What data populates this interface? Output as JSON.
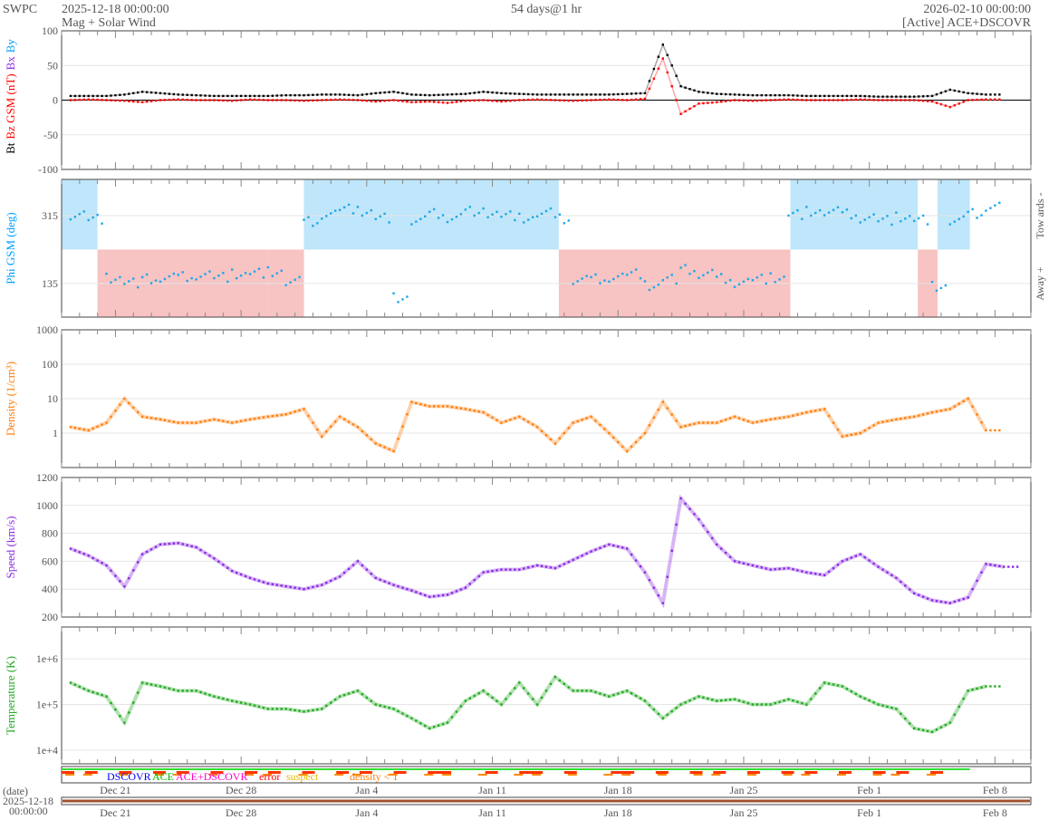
{
  "header": {
    "org": "SWPC",
    "start": "2025-12-18 00:00:00",
    "subtitle": "Mag + Solar Wind",
    "span": "54 days@1 hr",
    "end": "2026-02-10 00:00:00",
    "source": "[Active] ACE+DSCOVR"
  },
  "chart_data": {
    "type": "line",
    "x_unit": "days since 2025-12-18 00:00",
    "x_range": [
      0,
      54
    ],
    "x_ticks": [
      {
        "day": 3,
        "label": "Dec 21"
      },
      {
        "day": 10,
        "label": "Dec 28"
      },
      {
        "day": 17,
        "label": "Jan 4"
      },
      {
        "day": 24,
        "label": "Jan 11"
      },
      {
        "day": 31,
        "label": "Jan 18"
      },
      {
        "day": 38,
        "label": "Jan 25"
      },
      {
        "day": 45,
        "label": "Feb 1"
      },
      {
        "day": 52,
        "label": "Feb 8"
      }
    ],
    "panels": [
      {
        "id": "mag",
        "ylabel_parts": [
          {
            "text": "Bt",
            "color": "#000000"
          },
          {
            "text": "Bz GSM (nT)",
            "color": "#ff0000"
          },
          {
            "text": "Bx",
            "color": "#8a2be2"
          },
          {
            "text": "By",
            "color": "#00a0ff"
          }
        ],
        "scale": "linear",
        "ylim": [
          -100,
          100
        ],
        "yticks": [
          100,
          50,
          0,
          -50,
          -100
        ],
        "series": [
          {
            "name": "Bt",
            "color": "#000000",
            "values": [
              6,
              6,
              6,
              8,
              12,
              10,
              8,
              7,
              6,
              6,
              6,
              6,
              7,
              7,
              8,
              8,
              7,
              10,
              12,
              8,
              7,
              8,
              9,
              12,
              10,
              9,
              8,
              8,
              8,
              8,
              8,
              9,
              10,
              80,
              20,
              12,
              9,
              8,
              7,
              7,
              7,
              6,
              6,
              6,
              6,
              5,
              5,
              5,
              6,
              15,
              10,
              8
            ]
          },
          {
            "name": "Bz",
            "color": "#ff0000",
            "values": [
              0,
              1,
              0,
              -1,
              -3,
              0,
              1,
              0,
              0,
              -1,
              1,
              0,
              0,
              -1,
              0,
              1,
              0,
              -2,
              0,
              -3,
              -2,
              -4,
              -1,
              0,
              -2,
              0,
              1,
              0,
              -1,
              0,
              1,
              0,
              2,
              60,
              -20,
              -5,
              -3,
              0,
              -1,
              0,
              1,
              0,
              0,
              0,
              1,
              0,
              0,
              0,
              -2,
              -10,
              0,
              1
            ]
          }
        ]
      },
      {
        "id": "phi",
        "ylabel": "Phi GSM (deg)",
        "ylabel_color": "#00a0ff",
        "right_labels": [
          "Tow ards -",
          "Away +"
        ],
        "scale": "linear",
        "ylim": [
          46,
          411
        ],
        "yticks": [
          315,
          135
        ],
        "towards_color": "#bfe6fa",
        "away_color": "#f7c3c3",
        "sectors": [
          {
            "from": 0,
            "to": 2,
            "type": "towards"
          },
          {
            "from": 2,
            "to": 11.5,
            "type": "away"
          },
          {
            "from": 11.5,
            "to": 13.5,
            "type": "away"
          },
          {
            "from": 13.5,
            "to": 27.7,
            "type": "towards"
          },
          {
            "from": 27.7,
            "to": 40.6,
            "type": "away"
          },
          {
            "from": 40.6,
            "to": 47.7,
            "type": "towards"
          },
          {
            "from": 47.7,
            "to": 48.8,
            "type": "away"
          },
          {
            "from": 48.8,
            "to": 50.6,
            "type": "towards"
          }
        ],
        "series": [
          {
            "name": "Phi",
            "color": "#1ea7e8",
            "values": [
              320,
              305,
              150,
              140,
              145,
              150,
              155,
              160,
              150,
              160,
              165,
              170,
              140,
              300,
              320,
              330,
              325,
              310,
              100,
              300,
              320,
              310,
              330,
              320,
              315,
              310,
              320,
              305,
              145,
              150,
              155,
              160,
              130,
              150,
              170,
              160,
              150,
              140,
              145,
              150,
              320,
              330,
              325,
              320,
              310,
              300,
              310,
              305,
              130,
              300,
              320,
              340
            ]
          }
        ]
      },
      {
        "id": "density",
        "ylabel": "Density (1/cm³)",
        "ylabel_color": "#ff7f0e",
        "scale": "log",
        "ylim": [
          0.1,
          1000
        ],
        "yticks": [
          1000,
          100,
          10,
          1
        ],
        "series": [
          {
            "name": "Density",
            "color": "#ff7f0e",
            "values": [
              1.5,
              1.2,
              2,
              10,
              3,
              2.5,
              2,
              2,
              2.5,
              2,
              2.5,
              3,
              3.5,
              5,
              0.8,
              3,
              1.5,
              0.5,
              0.3,
              8,
              6,
              6,
              5,
              4,
              2,
              3,
              1.5,
              0.5,
              2,
              3,
              1,
              0.3,
              1,
              8,
              1.5,
              2,
              2,
              3,
              2,
              2.5,
              3,
              4,
              5,
              0.8,
              1,
              2,
              2.5,
              3,
              4,
              5,
              10,
              1.2
            ]
          }
        ]
      },
      {
        "id": "speed",
        "ylabel": "Speed (km/s)",
        "ylabel_color": "#8a2be2",
        "scale": "linear",
        "ylim": [
          200,
          1200
        ],
        "yticks": [
          1200,
          1000,
          800,
          600,
          400,
          200
        ],
        "series": [
          {
            "name": "Speed",
            "color": "#8a2be2",
            "values": [
              690,
              640,
              570,
              420,
              650,
              720,
              730,
              700,
              620,
              530,
              480,
              440,
              420,
              400,
              430,
              490,
              600,
              480,
              430,
              390,
              345,
              360,
              410,
              520,
              540,
              540,
              570,
              550,
              610,
              670,
              720,
              690,
              520,
              300,
              1050,
              900,
              720,
              600,
              570,
              540,
              550,
              520,
              500,
              600,
              650,
              560,
              480,
              370,
              320,
              300,
              340,
              580,
              560
            ]
          }
        ]
      },
      {
        "id": "temperature",
        "ylabel": "Temperature (K)",
        "ylabel_color": "#22aa22",
        "scale": "log",
        "ylim": [
          5000,
          5000000
        ],
        "yticks": [
          1000000,
          100000,
          10000
        ],
        "ytick_labels": [
          "1e+6",
          "1e+5",
          "1e+4"
        ],
        "series": [
          {
            "name": "Temperature",
            "color": "#22aa22",
            "values": [
              300000,
              200000,
              150000,
              40000,
              300000,
              250000,
              200000,
              200000,
              150000,
              120000,
              100000,
              80000,
              80000,
              70000,
              80000,
              150000,
              200000,
              100000,
              80000,
              50000,
              30000,
              40000,
              120000,
              200000,
              100000,
              300000,
              100000,
              400000,
              200000,
              200000,
              150000,
              200000,
              120000,
              50000,
              100000,
              150000,
              120000,
              130000,
              100000,
              100000,
              130000,
              100000,
              300000,
              250000,
              150000,
              100000,
              80000,
              30000,
              25000,
              40000,
              200000,
              250000
            ]
          }
        ]
      }
    ],
    "legend": [
      {
        "text": "DSCOVR",
        "color": "#0000ff"
      },
      {
        "text": "ACE",
        "color": "#00bb00"
      },
      {
        "text": "ACE+DSCOVR",
        "color": "#ff00cc"
      },
      {
        "text": "error",
        "color": "#ff0000"
      },
      {
        "text": "suspect",
        "color": "#e6b800"
      },
      {
        "text": "density < 1",
        "color": "#ff7f0e"
      }
    ],
    "bottom": {
      "label1": "(date)",
      "label2": "2025-12-18",
      "label3": "00:00:00"
    }
  }
}
